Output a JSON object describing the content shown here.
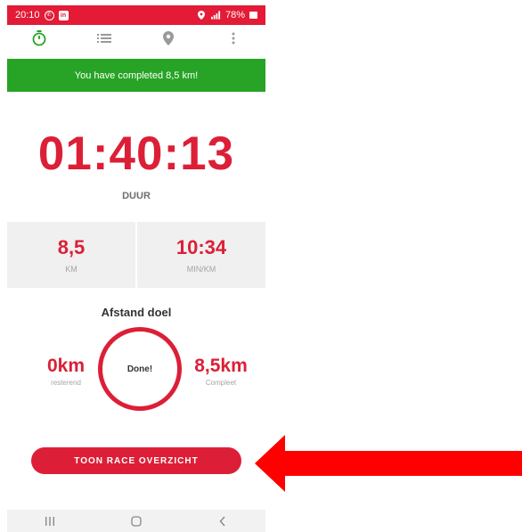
{
  "status_bar": {
    "time": "20:10",
    "battery": "78%",
    "left_icons": [
      "whatsapp-icon",
      "linkedin-icon"
    ],
    "right_icons": [
      "location-icon",
      "signal-icon",
      "battery-icon"
    ]
  },
  "toolbar": {
    "tabs": [
      {
        "icon": "stopwatch-icon",
        "active": true
      },
      {
        "icon": "list-icon",
        "active": false
      },
      {
        "icon": "map-pin-icon",
        "active": false
      },
      {
        "icon": "more-vert-icon",
        "active": false
      }
    ]
  },
  "banner": {
    "text": "You have completed 8,5 km!"
  },
  "timer": {
    "value": "01:40:13",
    "label": "DUUR"
  },
  "stats": [
    {
      "value": "8,5",
      "unit": "KM"
    },
    {
      "value": "10:34",
      "unit": "MIN/KM"
    }
  ],
  "goal": {
    "title": "Afstand doel",
    "remaining_value": "0km",
    "remaining_label": "resterend",
    "center_text": "Done!",
    "completed_value": "8,5km",
    "completed_label": "Compleet"
  },
  "cta": {
    "label": "TOON RACE OVERZICHT"
  },
  "nav": {
    "buttons": [
      "recent-apps-icon",
      "home-icon",
      "back-icon"
    ]
  },
  "colors": {
    "accent": "#dc1f37",
    "status_bar": "#e31b36",
    "banner": "#27a325",
    "annotation_arrow": "#ff0000"
  }
}
